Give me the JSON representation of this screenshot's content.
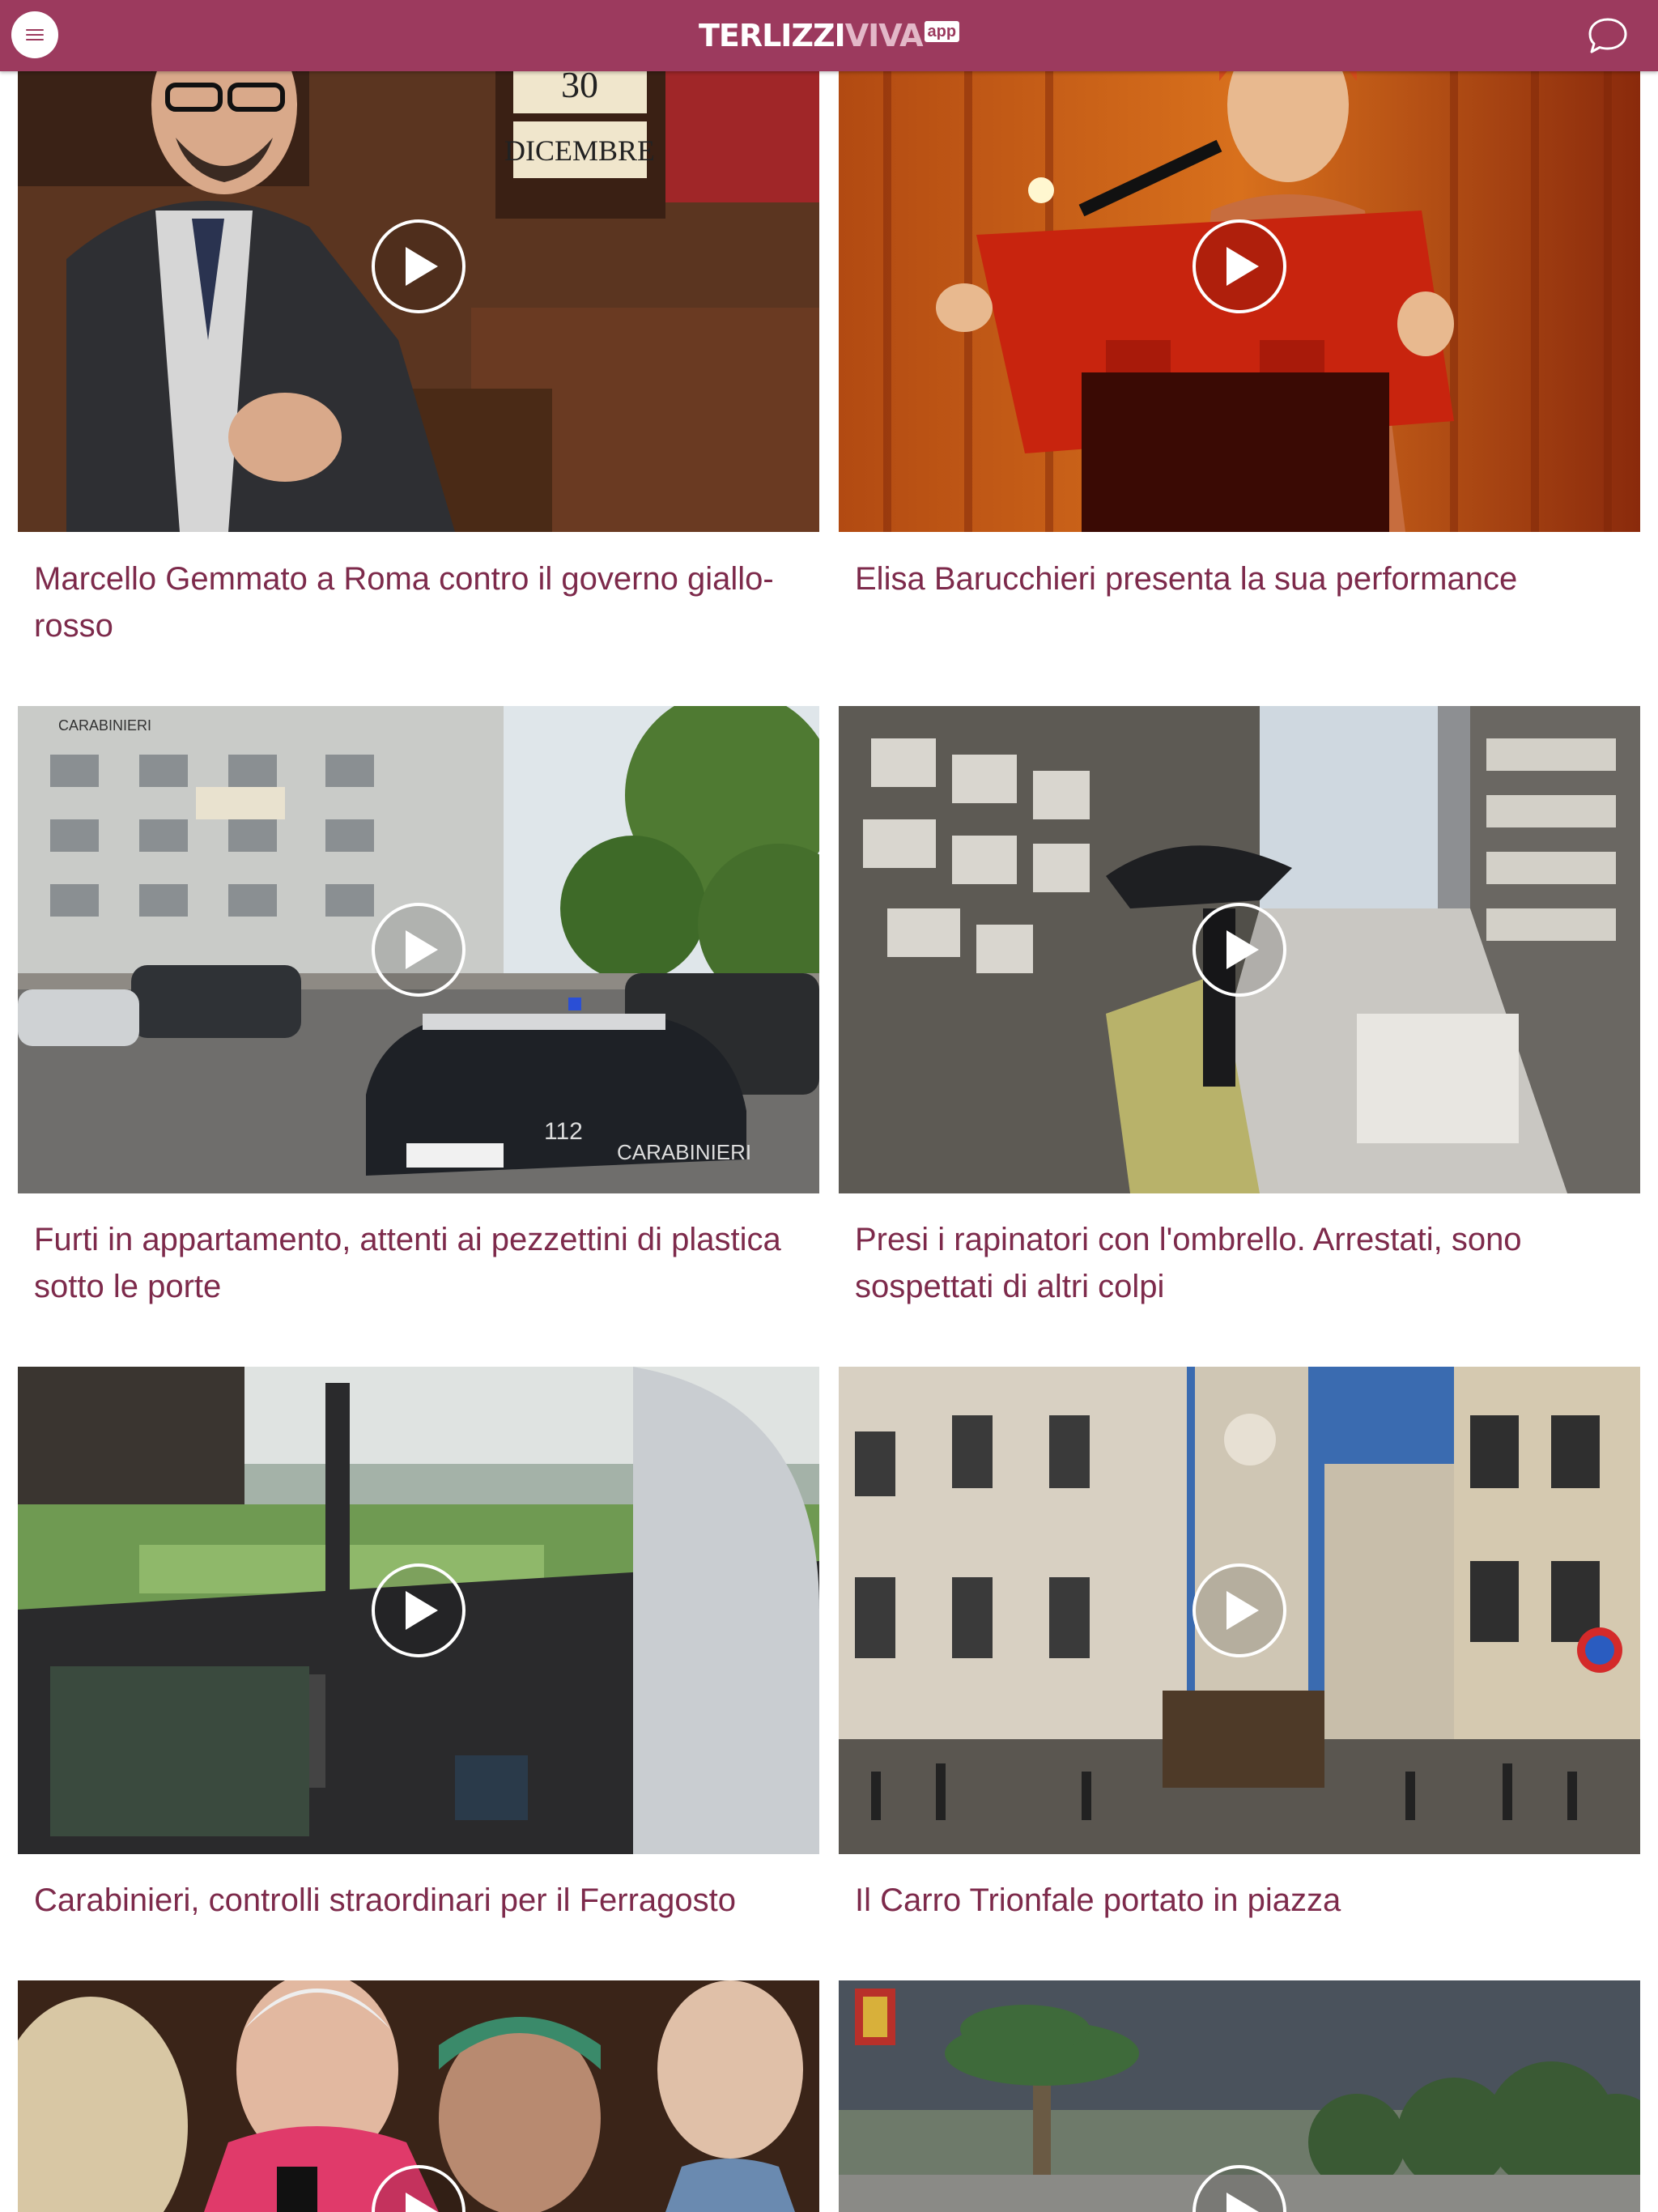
{
  "header": {
    "brand_part1": "TERLIZZI",
    "brand_part2": "VIVA",
    "brand_badge": "app",
    "menu_icon": "hamburger-menu-icon",
    "chat_icon": "speech-bubble-icon"
  },
  "colors": {
    "header_bg": "#9c3a5e",
    "title_text": "#7d2a4b"
  },
  "videos": [
    {
      "title": "Marcello Gemmato a Roma contro il governo giallo-rosso",
      "thumb_text": [
        "30",
        "DICEMBRE"
      ]
    },
    {
      "title": "Elisa Barucchieri presenta la sua performance"
    },
    {
      "title": "Furti in appartamento, attenti ai pezzettini di plastica sotto le porte",
      "thumb_text": [
        "CARABINIERI",
        "112",
        "CARABINIERI"
      ]
    },
    {
      "title": "Presi i rapinatori con l'ombrello. Arrestati, sono sospettati di altri colpi"
    },
    {
      "title": "Carabinieri, controlli straordinari per il Ferragosto"
    },
    {
      "title": "Il Carro Trionfale portato in piazza"
    },
    {
      "title": ""
    },
    {
      "title": ""
    }
  ]
}
